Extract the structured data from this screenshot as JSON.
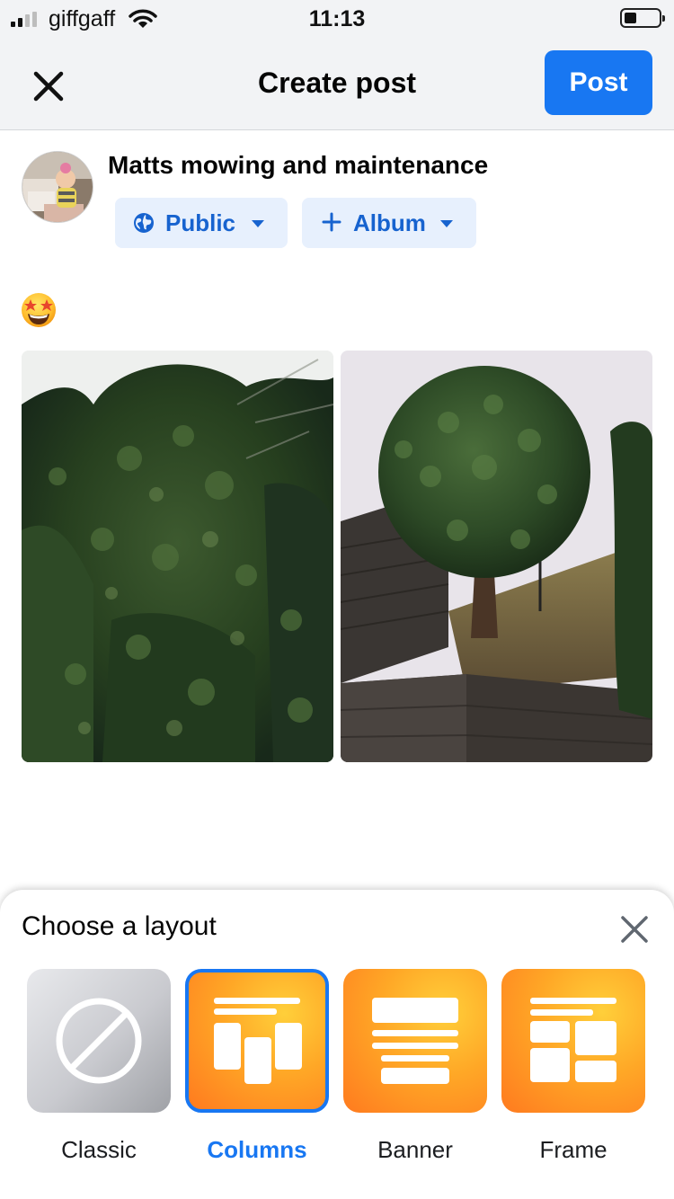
{
  "status_bar": {
    "carrier": "giffgaff",
    "time": "11:13",
    "battery_level": 0.35
  },
  "header": {
    "title": "Create post",
    "post_label": "Post",
    "accent_color": "#1877f2"
  },
  "composer": {
    "page_name": "Matts mowing and maintenance",
    "audience_label": "Public",
    "album_label": "Album",
    "post_text": "🤩",
    "photos": [
      {
        "icon": "hedge-photo-before"
      },
      {
        "icon": "hedge-photo-after"
      }
    ]
  },
  "layout_sheet": {
    "title": "Choose a layout",
    "options": [
      {
        "label": "Classic",
        "icon": "prohibited-icon",
        "selected": false
      },
      {
        "label": "Columns",
        "icon": "columns-layout-icon",
        "selected": true
      },
      {
        "label": "Banner",
        "icon": "banner-layout-icon",
        "selected": false
      },
      {
        "label": "Frame",
        "icon": "frame-layout-icon",
        "selected": false
      }
    ]
  }
}
